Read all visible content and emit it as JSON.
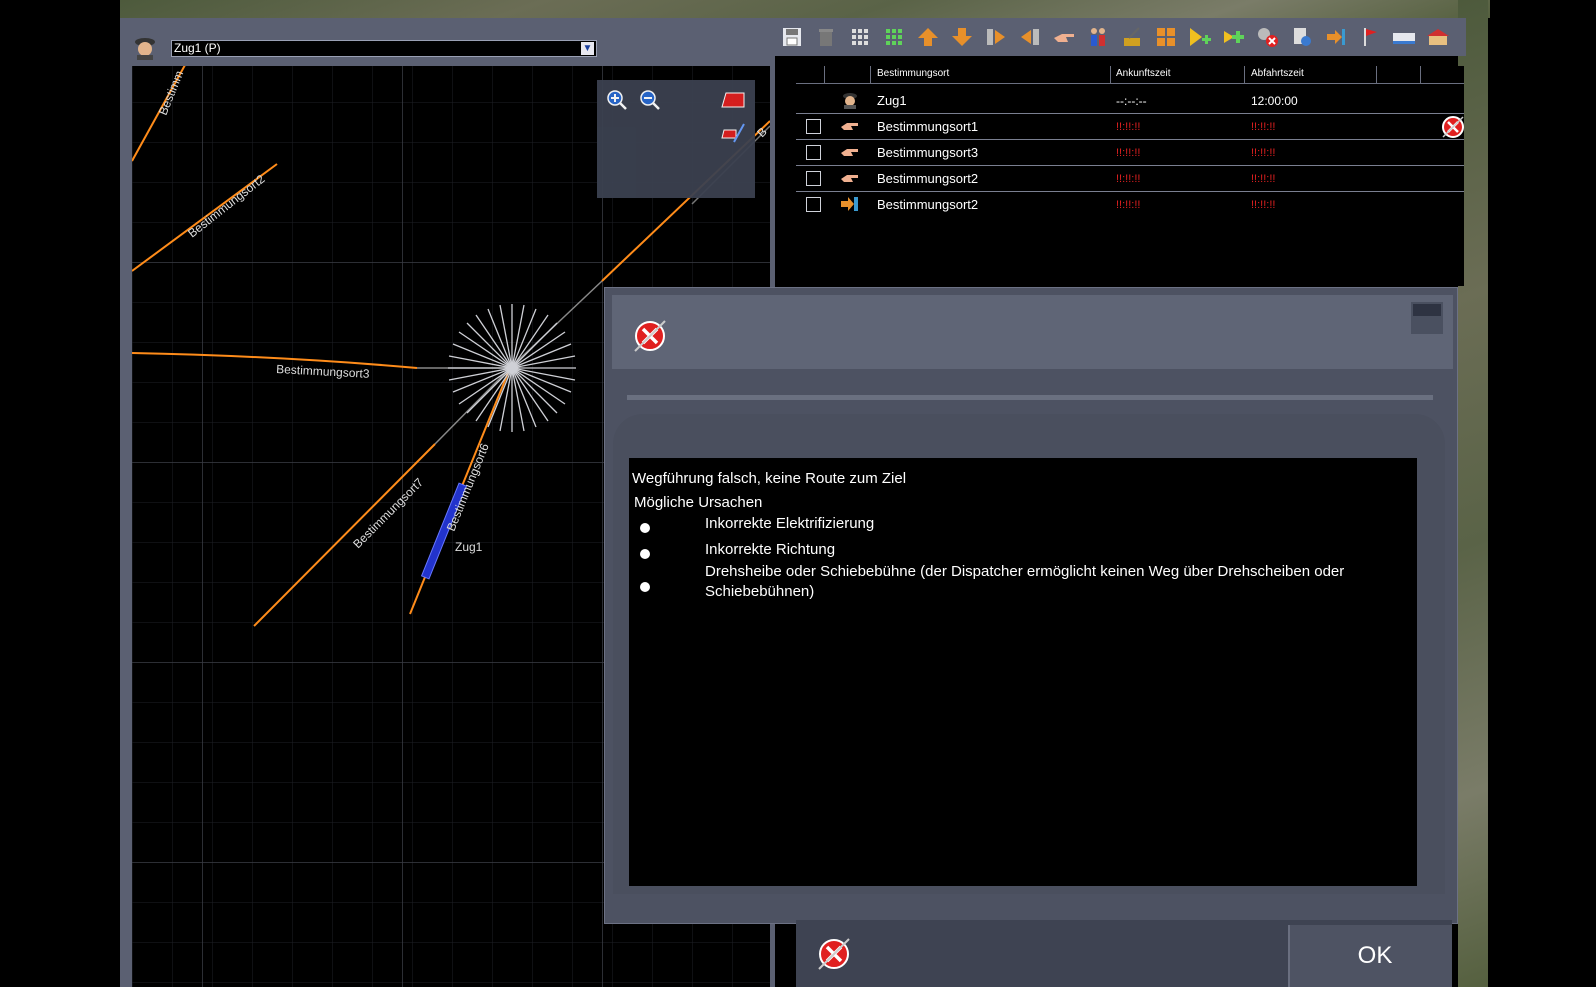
{
  "train_selector": {
    "value": "Zug1 (P)"
  },
  "map": {
    "track_labels": [
      "Bestimmungsort2",
      "Bestimmungsort3",
      "Bestimmungsort7",
      "Bestimmungsort6",
      "Bestimm",
      "B"
    ],
    "train_label": "Zug1",
    "tools": [
      "zoom-in-icon",
      "zoom-out-icon",
      "eraser-icon",
      "track-edit-icon"
    ]
  },
  "toolbar": {
    "buttons": [
      "save-icon",
      "trash-icon",
      "grid-small-icon",
      "grid-green-icon",
      "move-up-icon",
      "move-down-icon",
      "insert-before-icon",
      "insert-after-icon",
      "hand-point-icon",
      "passengers-icon",
      "crane-icon",
      "junction-icon",
      "add-waypoint-icon",
      "add-icon",
      "remove-signal-icon",
      "settings-icon",
      "exit-icon",
      "flag-icon",
      "ruler-icon",
      "depot-icon"
    ]
  },
  "schedule": {
    "headers": {
      "destination": "Bestimmungsort",
      "arrival": "Ankunftszeit",
      "departure": "Abfahrtszeit"
    },
    "train": {
      "name": "Zug1",
      "arrival": "--:--:--",
      "departure": "12:00:00"
    },
    "rows": [
      {
        "name": "Bestimmungsort1",
        "arrival": "!!:!!:!!",
        "departure": "!!:!!:!!",
        "icon": "hand-icon"
      },
      {
        "name": "Bestimmungsort3",
        "arrival": "!!:!!:!!",
        "departure": "!!:!!:!!",
        "icon": "hand-icon"
      },
      {
        "name": "Bestimmungsort2",
        "arrival": "!!:!!:!!",
        "departure": "!!:!!:!!",
        "icon": "hand-icon"
      },
      {
        "name": "Bestimmungsort2",
        "arrival": "!!:!!:!!",
        "departure": "!!:!!:!!",
        "icon": "exit-arrow-icon"
      }
    ]
  },
  "dialog": {
    "title": "Wegführung falsch, keine Route zum Ziel",
    "subtitle": "Mögliche Ursachen",
    "causes": [
      "Inkorrekte Elektrifizierung",
      "Inkorrekte Richtung",
      "Drehsheibe oder Schiebebühne (der Dispatcher ermöglicht keinen Weg über Drehscheiben oder Schiebebühnen)"
    ],
    "ok_label": "OK"
  },
  "colors": {
    "track": "#ff8c1a",
    "error": "#e02020",
    "train": "#2233cc"
  }
}
